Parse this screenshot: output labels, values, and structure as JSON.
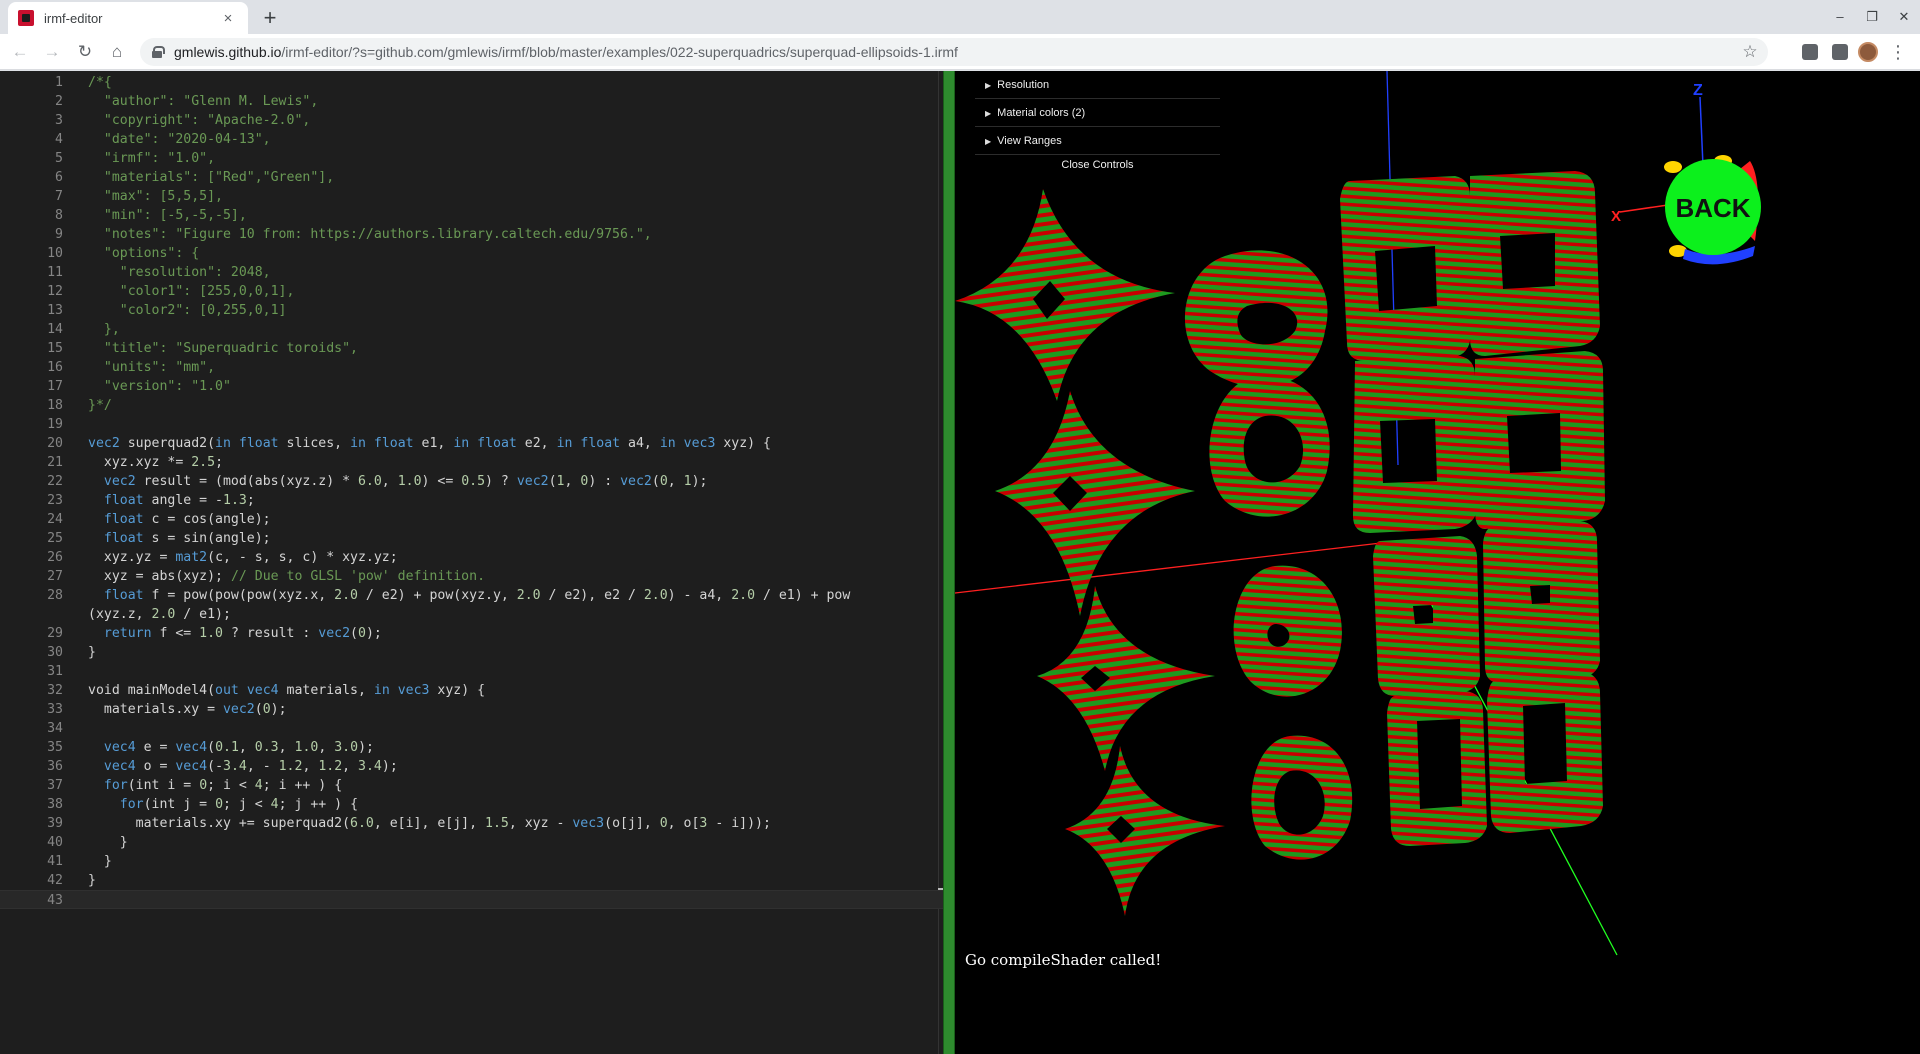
{
  "browser": {
    "tab_title": "irmf-editor",
    "tab_close": "×",
    "new_tab": "+",
    "window": {
      "minimize": "–",
      "restore": "❐",
      "close": "✕"
    },
    "nav": {
      "back": "←",
      "forward": "→",
      "reload": "↻",
      "home": "⌂"
    },
    "url_host": "gmlewis.github.io",
    "url_path": "/irmf-editor/?s=github.com/gmlewis/irmf/blob/master/examples/022-superquadrics/superquad-ellipsoids-1.irmf",
    "star": "☆",
    "menu": "⋮"
  },
  "editor": {
    "lines": [
      {
        "n": "1",
        "spans": [
          {
            "c": "cm",
            "t": "/*{"
          }
        ]
      },
      {
        "n": "2",
        "spans": [
          {
            "c": "cm",
            "t": "  \"author\": \"Glenn M. Lewis\","
          }
        ]
      },
      {
        "n": "3",
        "spans": [
          {
            "c": "cm",
            "t": "  \"copyright\": \"Apache-2.0\","
          }
        ]
      },
      {
        "n": "4",
        "spans": [
          {
            "c": "cm",
            "t": "  \"date\": \"2020-04-13\","
          }
        ]
      },
      {
        "n": "5",
        "spans": [
          {
            "c": "cm",
            "t": "  \"irmf\": \"1.0\","
          }
        ]
      },
      {
        "n": "6",
        "spans": [
          {
            "c": "cm",
            "t": "  \"materials\": [\"Red\",\"Green\"],"
          }
        ]
      },
      {
        "n": "7",
        "spans": [
          {
            "c": "cm",
            "t": "  \"max\": [5,5,5],"
          }
        ]
      },
      {
        "n": "8",
        "spans": [
          {
            "c": "cm",
            "t": "  \"min\": [-5,-5,-5],"
          }
        ]
      },
      {
        "n": "9",
        "spans": [
          {
            "c": "cm",
            "t": "  \"notes\": \"Figure 10 from: https://authors.library.caltech.edu/9756.\","
          }
        ]
      },
      {
        "n": "10",
        "spans": [
          {
            "c": "cm",
            "t": "  \"options\": {"
          }
        ]
      },
      {
        "n": "11",
        "spans": [
          {
            "c": "cm",
            "t": "    \"resolution\": 2048,"
          }
        ]
      },
      {
        "n": "12",
        "spans": [
          {
            "c": "cm",
            "t": "    \"color1\": [255,0,0,1],"
          }
        ]
      },
      {
        "n": "13",
        "spans": [
          {
            "c": "cm",
            "t": "    \"color2\": [0,255,0,1]"
          }
        ]
      },
      {
        "n": "14",
        "spans": [
          {
            "c": "cm",
            "t": "  },"
          }
        ]
      },
      {
        "n": "15",
        "spans": [
          {
            "c": "cm",
            "t": "  \"title\": \"Superquadric toroids\","
          }
        ]
      },
      {
        "n": "16",
        "spans": [
          {
            "c": "cm",
            "t": "  \"units\": \"mm\","
          }
        ]
      },
      {
        "n": "17",
        "spans": [
          {
            "c": "cm",
            "t": "  \"version\": \"1.0\""
          }
        ]
      },
      {
        "n": "18",
        "spans": [
          {
            "c": "cm",
            "t": "}*/"
          }
        ]
      },
      {
        "n": "19",
        "spans": []
      },
      {
        "n": "20",
        "spans": [
          {
            "c": "kw",
            "t": "vec2"
          },
          {
            "c": "",
            "t": " superquad2("
          },
          {
            "c": "kw",
            "t": "in"
          },
          {
            "c": "",
            "t": " "
          },
          {
            "c": "kw",
            "t": "float"
          },
          {
            "c": "",
            "t": " slices, "
          },
          {
            "c": "kw",
            "t": "in"
          },
          {
            "c": "",
            "t": " "
          },
          {
            "c": "kw",
            "t": "float"
          },
          {
            "c": "",
            "t": " e1, "
          },
          {
            "c": "kw",
            "t": "in"
          },
          {
            "c": "",
            "t": " "
          },
          {
            "c": "kw",
            "t": "float"
          },
          {
            "c": "",
            "t": " e2, "
          },
          {
            "c": "kw",
            "t": "in"
          },
          {
            "c": "",
            "t": " "
          },
          {
            "c": "kw",
            "t": "float"
          },
          {
            "c": "",
            "t": " a4, "
          },
          {
            "c": "kw",
            "t": "in"
          },
          {
            "c": "",
            "t": " "
          },
          {
            "c": "kw",
            "t": "vec3"
          },
          {
            "c": "",
            "t": " xyz) {"
          }
        ]
      },
      {
        "n": "21",
        "spans": [
          {
            "c": "",
            "t": "  xyz.xyz *= "
          },
          {
            "c": "nm",
            "t": "2.5"
          },
          {
            "c": "",
            "t": ";"
          }
        ]
      },
      {
        "n": "22",
        "spans": [
          {
            "c": "",
            "t": "  "
          },
          {
            "c": "kw",
            "t": "vec2"
          },
          {
            "c": "",
            "t": " result = (mod(abs(xyz.z) * "
          },
          {
            "c": "nm",
            "t": "6.0"
          },
          {
            "c": "",
            "t": ", "
          },
          {
            "c": "nm",
            "t": "1.0"
          },
          {
            "c": "",
            "t": ") <= "
          },
          {
            "c": "nm",
            "t": "0.5"
          },
          {
            "c": "",
            "t": ") ? "
          },
          {
            "c": "kw",
            "t": "vec2"
          },
          {
            "c": "",
            "t": "("
          },
          {
            "c": "nm",
            "t": "1"
          },
          {
            "c": "",
            "t": ", "
          },
          {
            "c": "nm",
            "t": "0"
          },
          {
            "c": "",
            "t": ") : "
          },
          {
            "c": "kw",
            "t": "vec2"
          },
          {
            "c": "",
            "t": "("
          },
          {
            "c": "nm",
            "t": "0"
          },
          {
            "c": "",
            "t": ", "
          },
          {
            "c": "nm",
            "t": "1"
          },
          {
            "c": "",
            "t": ");"
          }
        ]
      },
      {
        "n": "23",
        "spans": [
          {
            "c": "",
            "t": "  "
          },
          {
            "c": "kw",
            "t": "float"
          },
          {
            "c": "",
            "t": " angle = -"
          },
          {
            "c": "nm",
            "t": "1.3"
          },
          {
            "c": "",
            "t": ";"
          }
        ]
      },
      {
        "n": "24",
        "spans": [
          {
            "c": "",
            "t": "  "
          },
          {
            "c": "kw",
            "t": "float"
          },
          {
            "c": "",
            "t": " c = cos(angle);"
          }
        ]
      },
      {
        "n": "25",
        "spans": [
          {
            "c": "",
            "t": "  "
          },
          {
            "c": "kw",
            "t": "float"
          },
          {
            "c": "",
            "t": " s = sin(angle);"
          }
        ]
      },
      {
        "n": "26",
        "spans": [
          {
            "c": "",
            "t": "  xyz.yz = "
          },
          {
            "c": "kw",
            "t": "mat2"
          },
          {
            "c": "",
            "t": "(c, - s, s, c) * xyz.yz;"
          }
        ]
      },
      {
        "n": "27",
        "spans": [
          {
            "c": "",
            "t": "  xyz = abs(xyz); "
          },
          {
            "c": "cm",
            "t": "// Due to GLSL 'pow' definition."
          }
        ]
      },
      {
        "n": "28",
        "wrap": true,
        "spans": [
          {
            "c": "",
            "t": "  "
          },
          {
            "c": "kw",
            "t": "float"
          },
          {
            "c": "",
            "t": " f = pow(pow(pow(xyz.x, "
          },
          {
            "c": "nm",
            "t": "2.0"
          },
          {
            "c": "",
            "t": " / e2) + pow(xyz.y, "
          },
          {
            "c": "nm",
            "t": "2.0"
          },
          {
            "c": "",
            "t": " / e2), e2 / "
          },
          {
            "c": "nm",
            "t": "2.0"
          },
          {
            "c": "",
            "t": ") - a4, "
          },
          {
            "c": "nm",
            "t": "2.0"
          },
          {
            "c": "",
            "t": " / e1) + pow\n(xyz.z, "
          },
          {
            "c": "nm",
            "t": "2.0"
          },
          {
            "c": "",
            "t": " / e1);"
          }
        ]
      },
      {
        "n": "29",
        "spans": [
          {
            "c": "",
            "t": "  "
          },
          {
            "c": "kw",
            "t": "return"
          },
          {
            "c": "",
            "t": " f <= "
          },
          {
            "c": "nm",
            "t": "1.0"
          },
          {
            "c": "",
            "t": " ? result : "
          },
          {
            "c": "kw",
            "t": "vec2"
          },
          {
            "c": "",
            "t": "("
          },
          {
            "c": "nm",
            "t": "0"
          },
          {
            "c": "",
            "t": ");"
          }
        ]
      },
      {
        "n": "30",
        "spans": [
          {
            "c": "",
            "t": "}"
          }
        ]
      },
      {
        "n": "31",
        "spans": []
      },
      {
        "n": "32",
        "spans": [
          {
            "c": "",
            "t": "void mainModel4("
          },
          {
            "c": "kw",
            "t": "out"
          },
          {
            "c": "",
            "t": " "
          },
          {
            "c": "kw",
            "t": "vec4"
          },
          {
            "c": "",
            "t": " materials, "
          },
          {
            "c": "kw",
            "t": "in"
          },
          {
            "c": "",
            "t": " "
          },
          {
            "c": "kw",
            "t": "vec3"
          },
          {
            "c": "",
            "t": " xyz) {"
          }
        ]
      },
      {
        "n": "33",
        "spans": [
          {
            "c": "",
            "t": "  materials.xy = "
          },
          {
            "c": "kw",
            "t": "vec2"
          },
          {
            "c": "",
            "t": "("
          },
          {
            "c": "nm",
            "t": "0"
          },
          {
            "c": "",
            "t": ");"
          }
        ]
      },
      {
        "n": "34",
        "spans": []
      },
      {
        "n": "35",
        "spans": [
          {
            "c": "",
            "t": "  "
          },
          {
            "c": "kw",
            "t": "vec4"
          },
          {
            "c": "",
            "t": " e = "
          },
          {
            "c": "kw",
            "t": "vec4"
          },
          {
            "c": "",
            "t": "("
          },
          {
            "c": "nm",
            "t": "0.1"
          },
          {
            "c": "",
            "t": ", "
          },
          {
            "c": "nm",
            "t": "0.3"
          },
          {
            "c": "",
            "t": ", "
          },
          {
            "c": "nm",
            "t": "1.0"
          },
          {
            "c": "",
            "t": ", "
          },
          {
            "c": "nm",
            "t": "3.0"
          },
          {
            "c": "",
            "t": ");"
          }
        ]
      },
      {
        "n": "36",
        "spans": [
          {
            "c": "",
            "t": "  "
          },
          {
            "c": "kw",
            "t": "vec4"
          },
          {
            "c": "",
            "t": " o = "
          },
          {
            "c": "kw",
            "t": "vec4"
          },
          {
            "c": "",
            "t": "(-"
          },
          {
            "c": "nm",
            "t": "3.4"
          },
          {
            "c": "",
            "t": ", - "
          },
          {
            "c": "nm",
            "t": "1.2"
          },
          {
            "c": "",
            "t": ", "
          },
          {
            "c": "nm",
            "t": "1.2"
          },
          {
            "c": "",
            "t": ", "
          },
          {
            "c": "nm",
            "t": "3.4"
          },
          {
            "c": "",
            "t": ");"
          }
        ]
      },
      {
        "n": "37",
        "spans": [
          {
            "c": "",
            "t": "  "
          },
          {
            "c": "kw",
            "t": "for"
          },
          {
            "c": "",
            "t": "(int i = "
          },
          {
            "c": "nm",
            "t": "0"
          },
          {
            "c": "",
            "t": "; i < "
          },
          {
            "c": "nm",
            "t": "4"
          },
          {
            "c": "",
            "t": "; i ++ ) {"
          }
        ]
      },
      {
        "n": "38",
        "spans": [
          {
            "c": "",
            "t": "    "
          },
          {
            "c": "kw",
            "t": "for"
          },
          {
            "c": "",
            "t": "(int j = "
          },
          {
            "c": "nm",
            "t": "0"
          },
          {
            "c": "",
            "t": "; j < "
          },
          {
            "c": "nm",
            "t": "4"
          },
          {
            "c": "",
            "t": "; j ++ ) {"
          }
        ]
      },
      {
        "n": "39",
        "spans": [
          {
            "c": "",
            "t": "      materials.xy += superquad2("
          },
          {
            "c": "nm",
            "t": "6.0"
          },
          {
            "c": "",
            "t": ", e[i], e[j], "
          },
          {
            "c": "nm",
            "t": "1.5"
          },
          {
            "c": "",
            "t": ", xyz - "
          },
          {
            "c": "kw",
            "t": "vec3"
          },
          {
            "c": "",
            "t": "(o[j], "
          },
          {
            "c": "nm",
            "t": "0"
          },
          {
            "c": "",
            "t": ", o["
          },
          {
            "c": "nm",
            "t": "3"
          },
          {
            "c": "",
            "t": " - i]));"
          }
        ]
      },
      {
        "n": "40",
        "spans": [
          {
            "c": "",
            "t": "    }"
          }
        ]
      },
      {
        "n": "41",
        "spans": [
          {
            "c": "",
            "t": "  }"
          }
        ]
      },
      {
        "n": "42",
        "spans": [
          {
            "c": "",
            "t": "}"
          }
        ]
      },
      {
        "n": "43",
        "current": true,
        "spans": []
      }
    ]
  },
  "gui": {
    "folders": [
      {
        "label": "Resolution"
      },
      {
        "label": "Material colors (2)"
      },
      {
        "label": "View Ranges"
      }
    ],
    "close_label": "Close Controls"
  },
  "viewcube": {
    "z_label": "Z",
    "x_label": "X",
    "face_label": "BACK"
  },
  "colors": {
    "material1": "#c80000",
    "material2": "#1e9a1e",
    "axis_x": "#ff2020",
    "axis_y": "#20ff20",
    "axis_z": "#2040ff",
    "splitter": "#2e8b2e"
  },
  "console_message": "Go compileShader called!"
}
